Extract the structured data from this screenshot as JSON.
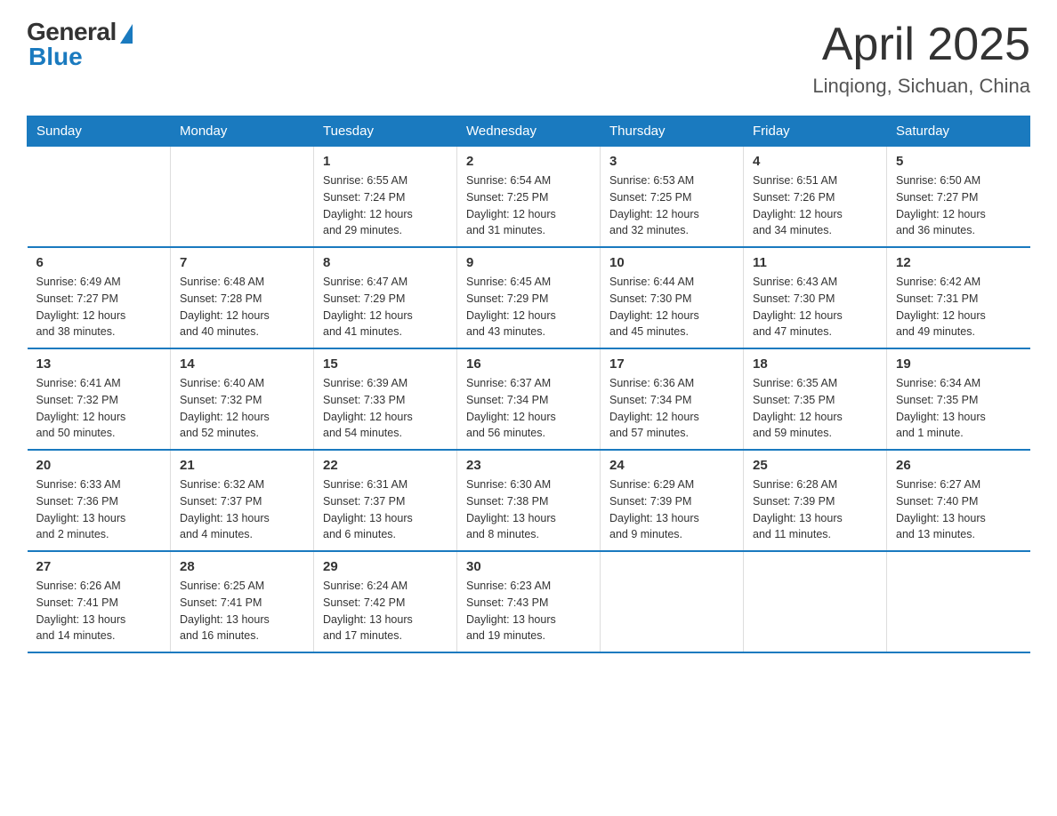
{
  "logo": {
    "general": "General",
    "blue": "Blue"
  },
  "title": "April 2025",
  "location": "Linqiong, Sichuan, China",
  "days_of_week": [
    "Sunday",
    "Monday",
    "Tuesday",
    "Wednesday",
    "Thursday",
    "Friday",
    "Saturday"
  ],
  "weeks": [
    [
      {
        "day": "",
        "info": ""
      },
      {
        "day": "",
        "info": ""
      },
      {
        "day": "1",
        "info": "Sunrise: 6:55 AM\nSunset: 7:24 PM\nDaylight: 12 hours\nand 29 minutes."
      },
      {
        "day": "2",
        "info": "Sunrise: 6:54 AM\nSunset: 7:25 PM\nDaylight: 12 hours\nand 31 minutes."
      },
      {
        "day": "3",
        "info": "Sunrise: 6:53 AM\nSunset: 7:25 PM\nDaylight: 12 hours\nand 32 minutes."
      },
      {
        "day": "4",
        "info": "Sunrise: 6:51 AM\nSunset: 7:26 PM\nDaylight: 12 hours\nand 34 minutes."
      },
      {
        "day": "5",
        "info": "Sunrise: 6:50 AM\nSunset: 7:27 PM\nDaylight: 12 hours\nand 36 minutes."
      }
    ],
    [
      {
        "day": "6",
        "info": "Sunrise: 6:49 AM\nSunset: 7:27 PM\nDaylight: 12 hours\nand 38 minutes."
      },
      {
        "day": "7",
        "info": "Sunrise: 6:48 AM\nSunset: 7:28 PM\nDaylight: 12 hours\nand 40 minutes."
      },
      {
        "day": "8",
        "info": "Sunrise: 6:47 AM\nSunset: 7:29 PM\nDaylight: 12 hours\nand 41 minutes."
      },
      {
        "day": "9",
        "info": "Sunrise: 6:45 AM\nSunset: 7:29 PM\nDaylight: 12 hours\nand 43 minutes."
      },
      {
        "day": "10",
        "info": "Sunrise: 6:44 AM\nSunset: 7:30 PM\nDaylight: 12 hours\nand 45 minutes."
      },
      {
        "day": "11",
        "info": "Sunrise: 6:43 AM\nSunset: 7:30 PM\nDaylight: 12 hours\nand 47 minutes."
      },
      {
        "day": "12",
        "info": "Sunrise: 6:42 AM\nSunset: 7:31 PM\nDaylight: 12 hours\nand 49 minutes."
      }
    ],
    [
      {
        "day": "13",
        "info": "Sunrise: 6:41 AM\nSunset: 7:32 PM\nDaylight: 12 hours\nand 50 minutes."
      },
      {
        "day": "14",
        "info": "Sunrise: 6:40 AM\nSunset: 7:32 PM\nDaylight: 12 hours\nand 52 minutes."
      },
      {
        "day": "15",
        "info": "Sunrise: 6:39 AM\nSunset: 7:33 PM\nDaylight: 12 hours\nand 54 minutes."
      },
      {
        "day": "16",
        "info": "Sunrise: 6:37 AM\nSunset: 7:34 PM\nDaylight: 12 hours\nand 56 minutes."
      },
      {
        "day": "17",
        "info": "Sunrise: 6:36 AM\nSunset: 7:34 PM\nDaylight: 12 hours\nand 57 minutes."
      },
      {
        "day": "18",
        "info": "Sunrise: 6:35 AM\nSunset: 7:35 PM\nDaylight: 12 hours\nand 59 minutes."
      },
      {
        "day": "19",
        "info": "Sunrise: 6:34 AM\nSunset: 7:35 PM\nDaylight: 13 hours\nand 1 minute."
      }
    ],
    [
      {
        "day": "20",
        "info": "Sunrise: 6:33 AM\nSunset: 7:36 PM\nDaylight: 13 hours\nand 2 minutes."
      },
      {
        "day": "21",
        "info": "Sunrise: 6:32 AM\nSunset: 7:37 PM\nDaylight: 13 hours\nand 4 minutes."
      },
      {
        "day": "22",
        "info": "Sunrise: 6:31 AM\nSunset: 7:37 PM\nDaylight: 13 hours\nand 6 minutes."
      },
      {
        "day": "23",
        "info": "Sunrise: 6:30 AM\nSunset: 7:38 PM\nDaylight: 13 hours\nand 8 minutes."
      },
      {
        "day": "24",
        "info": "Sunrise: 6:29 AM\nSunset: 7:39 PM\nDaylight: 13 hours\nand 9 minutes."
      },
      {
        "day": "25",
        "info": "Sunrise: 6:28 AM\nSunset: 7:39 PM\nDaylight: 13 hours\nand 11 minutes."
      },
      {
        "day": "26",
        "info": "Sunrise: 6:27 AM\nSunset: 7:40 PM\nDaylight: 13 hours\nand 13 minutes."
      }
    ],
    [
      {
        "day": "27",
        "info": "Sunrise: 6:26 AM\nSunset: 7:41 PM\nDaylight: 13 hours\nand 14 minutes."
      },
      {
        "day": "28",
        "info": "Sunrise: 6:25 AM\nSunset: 7:41 PM\nDaylight: 13 hours\nand 16 minutes."
      },
      {
        "day": "29",
        "info": "Sunrise: 6:24 AM\nSunset: 7:42 PM\nDaylight: 13 hours\nand 17 minutes."
      },
      {
        "day": "30",
        "info": "Sunrise: 6:23 AM\nSunset: 7:43 PM\nDaylight: 13 hours\nand 19 minutes."
      },
      {
        "day": "",
        "info": ""
      },
      {
        "day": "",
        "info": ""
      },
      {
        "day": "",
        "info": ""
      }
    ]
  ]
}
